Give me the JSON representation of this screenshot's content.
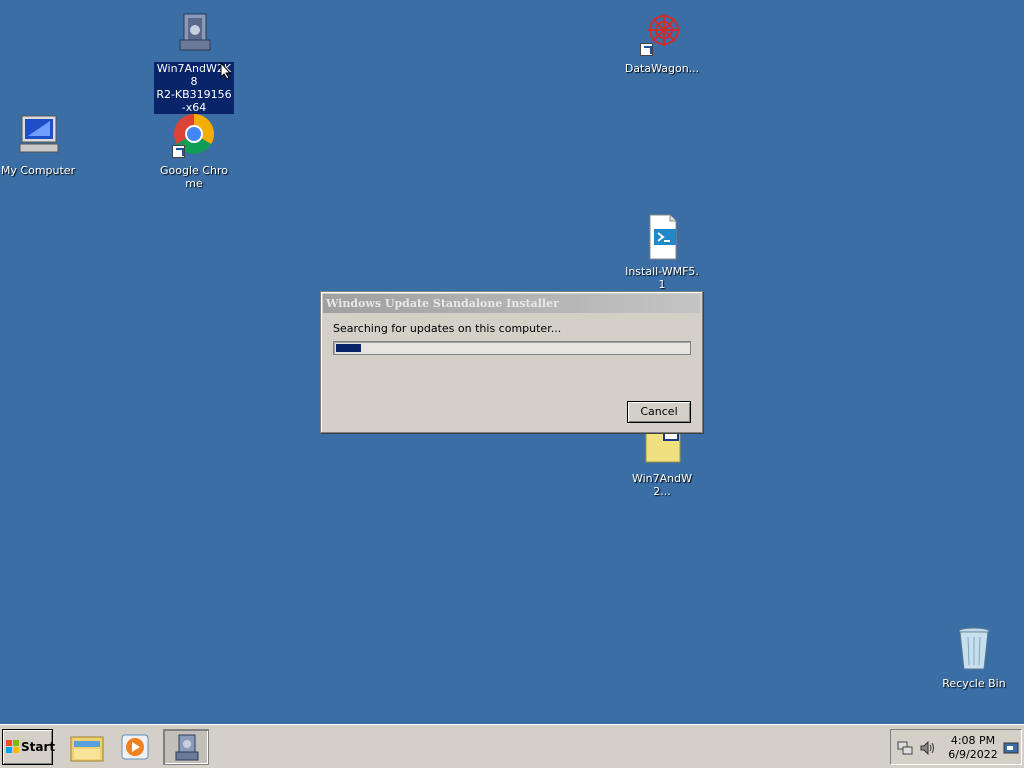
{
  "desktop": {
    "icons": [
      {
        "label": "Win7AndW2K8\nR2-KB319156\n-x64",
        "icon": "installer-package-icon"
      },
      {
        "label": "DataWagon...",
        "icon": "datawagon-icon"
      },
      {
        "label": "My Computer",
        "icon": "computer-icon"
      },
      {
        "label": "Google Chrome",
        "icon": "chrome-icon"
      },
      {
        "label": "Install-WMF5.1",
        "icon": "powershell-script-icon"
      },
      {
        "label": "Win7AndW2...",
        "icon": "folder-icon"
      },
      {
        "label": "Recycle Bin",
        "icon": "recycle-bin-icon"
      }
    ]
  },
  "dialog": {
    "title": "Windows Update Standalone Installer",
    "status": "Searching for updates on this computer...",
    "progress_percent": 7,
    "cancel_label": "Cancel"
  },
  "taskbar": {
    "start_label": "Start",
    "pinned": [
      "explorer-icon",
      "media-player-icon",
      "installer-package-icon"
    ],
    "tray": {
      "time": "4:08 PM",
      "date": "6/9/2022",
      "icons": [
        "network-icon",
        "volume-icon",
        "show-desktop-icon"
      ]
    }
  },
  "colors": {
    "desktop_bg": "#3a6ea5",
    "selection": "#0a246a",
    "progress_fill": "#0a246a"
  }
}
